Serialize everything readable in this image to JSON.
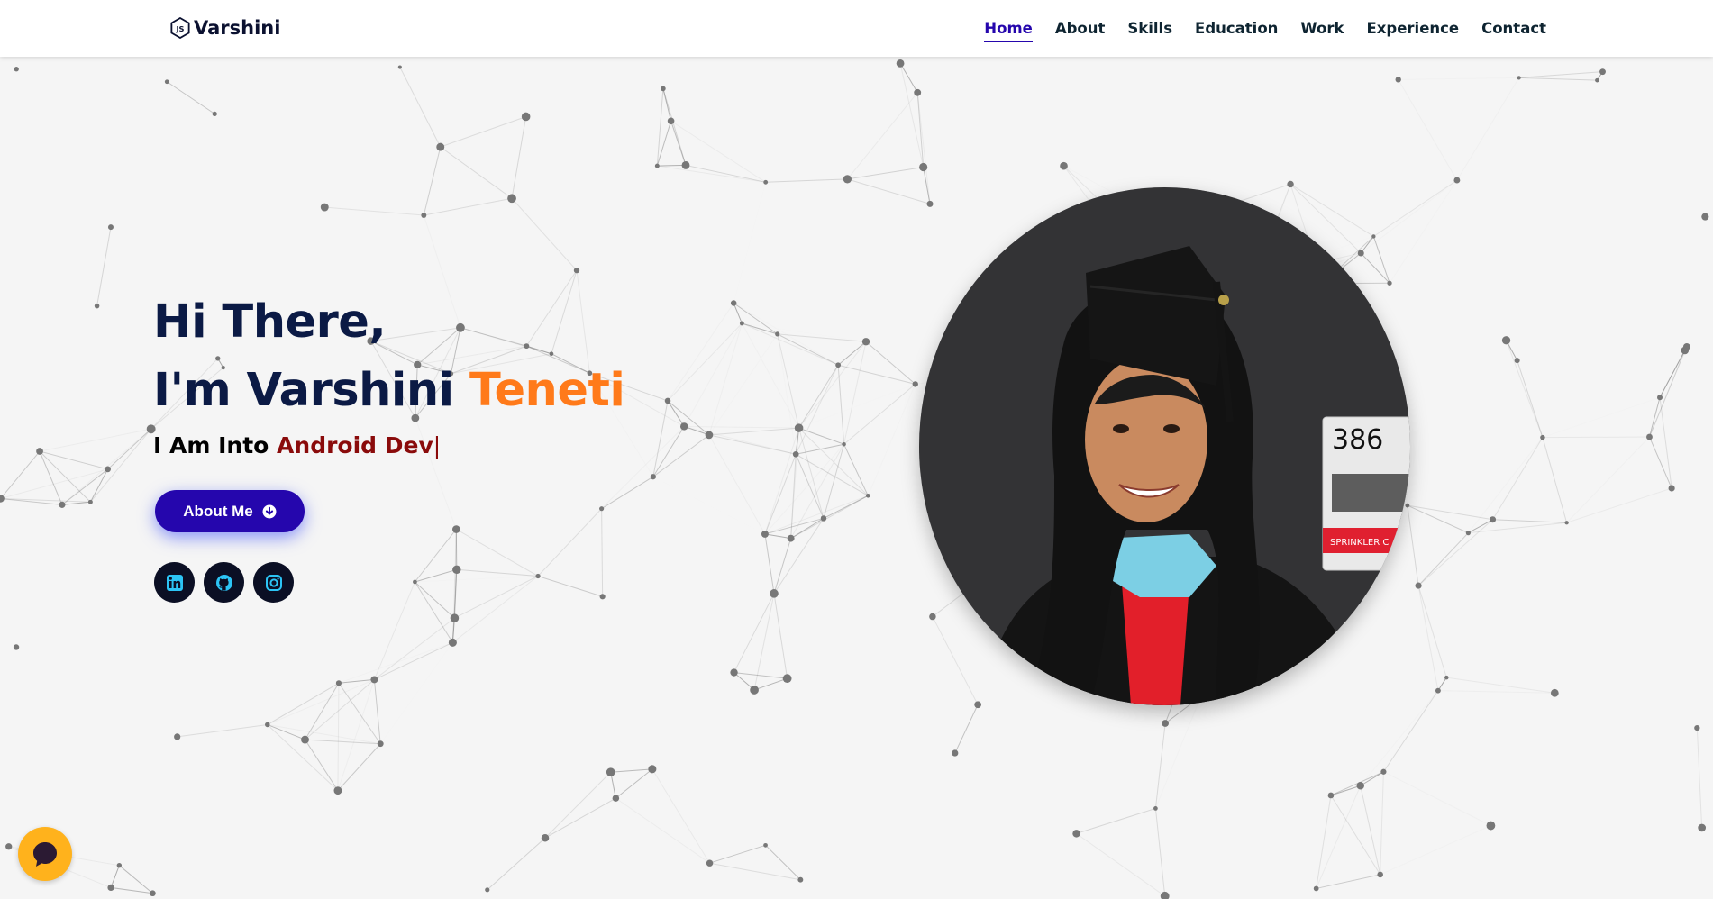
{
  "header": {
    "brand": "Varshini",
    "brand_icon": "nodejs-icon",
    "nav": [
      {
        "label": "Home",
        "active": true
      },
      {
        "label": "About",
        "active": false
      },
      {
        "label": "Skills",
        "active": false
      },
      {
        "label": "Education",
        "active": false
      },
      {
        "label": "Work",
        "active": false
      },
      {
        "label": "Experience",
        "active": false
      },
      {
        "label": "Contact",
        "active": false
      }
    ]
  },
  "hero": {
    "greeting_line1": "Hi There,",
    "greeting_line2_prefix": "I'm Varshini ",
    "greeting_line2_accent": "Teneti",
    "typed_prefix": "I Am Into ",
    "typed_role": "Android Dev",
    "typed_cursor": "|",
    "about_button": "About Me",
    "about_button_icon": "arrow-circle-down-icon",
    "socials": [
      {
        "name": "linkedin-icon"
      },
      {
        "name": "github-icon"
      },
      {
        "name": "instagram-icon"
      }
    ],
    "photo_sign_number": "386",
    "photo_sign_text": "SPRINKLER C"
  },
  "colors": {
    "accent_orange": "#ff7a1a",
    "primary_button": "#2506ad",
    "heading_navy": "#0b1a45",
    "role_red": "#8a0b0b",
    "chat_yellow": "#ffb21c",
    "social_icon": "#2cc4f5"
  },
  "chat": {
    "icon": "chat-bubble-icon"
  }
}
